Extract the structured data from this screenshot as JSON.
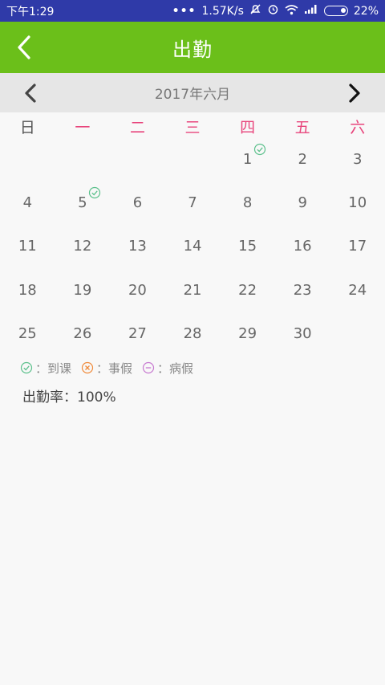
{
  "status": {
    "time": "下午1:29",
    "speed": "1.57K/s",
    "battery": "22%"
  },
  "appbar": {
    "title": "出勤"
  },
  "month": {
    "label": "2017年六月"
  },
  "weekdays": [
    "日",
    "一",
    "二",
    "三",
    "四",
    "五",
    "六"
  ],
  "calendar": {
    "weeks": [
      [
        "",
        "",
        "",
        "",
        "1",
        "2",
        "3"
      ],
      [
        "4",
        "5",
        "6",
        "7",
        "8",
        "9",
        "10"
      ],
      [
        "11",
        "12",
        "13",
        "14",
        "15",
        "16",
        "17"
      ],
      [
        "18",
        "19",
        "20",
        "21",
        "22",
        "23",
        "24"
      ],
      [
        "25",
        "26",
        "27",
        "28",
        "29",
        "30",
        ""
      ]
    ],
    "attended_days": [
      "1",
      "5"
    ]
  },
  "legend": {
    "attend": "：到课",
    "leave": "：事假",
    "sick": "：病假"
  },
  "rate": "出勤率：100%",
  "colors": {
    "statusbar": "#2f3aa8",
    "appbar": "#6bbf1a",
    "weekend_day": "#e8457c",
    "check": "#5cc08c",
    "leave": "#f08a3a",
    "sick": "#c77ad0"
  }
}
